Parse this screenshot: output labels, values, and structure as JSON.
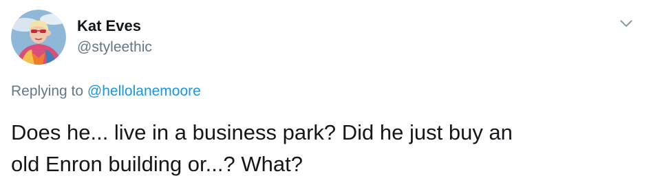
{
  "tweet": {
    "author": {
      "display_name": "Kat Eves",
      "username": "@styleethic",
      "avatar_icon": "profile-photo"
    },
    "menu_icon": "chevron-down-icon",
    "replying": {
      "prefix": "Replying to ",
      "mention": "@hellolanemoore"
    },
    "text_lines": [
      "Does he... live in a business park? Did he just buy an",
      "old Enron building or...? What?"
    ]
  },
  "colors": {
    "primary_text": "#14171a",
    "secondary_text": "#657786",
    "link": "#1b95e0",
    "background": "#ffffff"
  }
}
